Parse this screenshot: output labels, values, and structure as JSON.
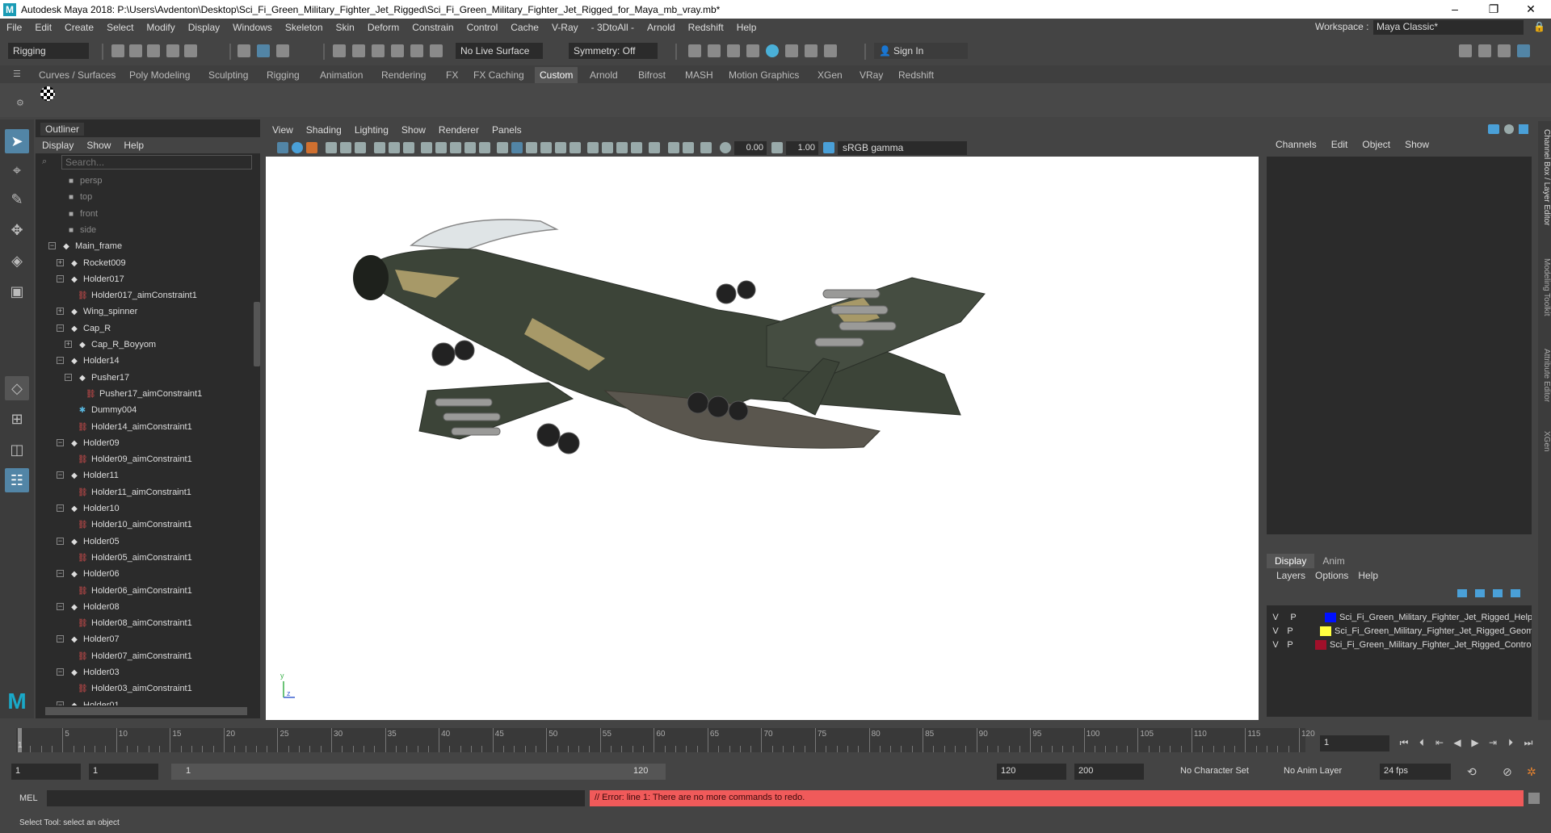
{
  "window": {
    "title": "Autodesk Maya 2018: P:\\Users\\Avdenton\\Desktop\\Sci_Fi_Green_Military_Fighter_Jet_Rigged\\Sci_Fi_Green_Military_Fighter_Jet_Rigged_for_Maya_mb_vray.mb*",
    "logo": "M",
    "minimize": "–",
    "maximize": "❐",
    "close": "✕"
  },
  "menubar": {
    "items": [
      "File",
      "Edit",
      "Create",
      "Select",
      "Modify",
      "Display",
      "Windows",
      "Skeleton",
      "Skin",
      "Deform",
      "Constrain",
      "Control",
      "Cache",
      "V-Ray",
      "- 3DtoAll -",
      "Arnold",
      "Redshift",
      "Help"
    ],
    "workspace_label": "Workspace :",
    "workspace_value": "Maya Classic*"
  },
  "statusline": {
    "menuset": "Rigging",
    "live_surface": "No Live Surface",
    "symmetry": "Symmetry: Off",
    "sign_in": "Sign In"
  },
  "shelf": {
    "tabs": [
      "Curves / Surfaces",
      "Poly Modeling",
      "Sculpting",
      "Rigging",
      "Animation",
      "Rendering",
      "FX",
      "FX Caching",
      "Custom",
      "Arnold",
      "Bifrost",
      "MASH",
      "Motion Graphics",
      "XGen",
      "VRay",
      "Redshift"
    ],
    "active_tab": "Custom"
  },
  "outliner": {
    "title": "Outliner",
    "menu": [
      "Display",
      "Show",
      "Help"
    ],
    "search_placeholder": "Search...",
    "items": [
      {
        "label": "persp",
        "type": "camera",
        "depth": 0,
        "expand": ""
      },
      {
        "label": "top",
        "type": "camera",
        "depth": 0,
        "expand": ""
      },
      {
        "label": "front",
        "type": "camera",
        "depth": 0,
        "expand": ""
      },
      {
        "label": "side",
        "type": "camera",
        "depth": 0,
        "expand": ""
      },
      {
        "label": "Main_frame",
        "type": "transform",
        "depth": 0,
        "expand": "−"
      },
      {
        "label": "Rocket009",
        "type": "transform",
        "depth": 1,
        "expand": "+"
      },
      {
        "label": "Holder017",
        "type": "transform",
        "depth": 1,
        "expand": "−"
      },
      {
        "label": "Holder017_aimConstraint1",
        "type": "constraint",
        "depth": 2,
        "expand": ""
      },
      {
        "label": "Wing_spinner",
        "type": "transform",
        "depth": 1,
        "expand": "+"
      },
      {
        "label": "Cap_R",
        "type": "transform",
        "depth": 1,
        "expand": "−"
      },
      {
        "label": "Cap_R_Boyyom",
        "type": "transform",
        "depth": 2,
        "expand": "+"
      },
      {
        "label": "Holder14",
        "type": "transform",
        "depth": 1,
        "expand": "−"
      },
      {
        "label": "Pusher17",
        "type": "transform",
        "depth": 2,
        "expand": "−"
      },
      {
        "label": "Pusher17_aimConstraint1",
        "type": "constraint",
        "depth": 3,
        "expand": ""
      },
      {
        "label": "Dummy004",
        "type": "dummy",
        "depth": 2,
        "expand": ""
      },
      {
        "label": "Holder14_aimConstraint1",
        "type": "constraint",
        "depth": 2,
        "expand": ""
      },
      {
        "label": "Holder09",
        "type": "transform",
        "depth": 1,
        "expand": "−"
      },
      {
        "label": "Holder09_aimConstraint1",
        "type": "constraint",
        "depth": 2,
        "expand": ""
      },
      {
        "label": "Holder11",
        "type": "transform",
        "depth": 1,
        "expand": "−"
      },
      {
        "label": "Holder11_aimConstraint1",
        "type": "constraint",
        "depth": 2,
        "expand": ""
      },
      {
        "label": "Holder10",
        "type": "transform",
        "depth": 1,
        "expand": "−"
      },
      {
        "label": "Holder10_aimConstraint1",
        "type": "constraint",
        "depth": 2,
        "expand": ""
      },
      {
        "label": "Holder05",
        "type": "transform",
        "depth": 1,
        "expand": "−"
      },
      {
        "label": "Holder05_aimConstraint1",
        "type": "constraint",
        "depth": 2,
        "expand": ""
      },
      {
        "label": "Holder06",
        "type": "transform",
        "depth": 1,
        "expand": "−"
      },
      {
        "label": "Holder06_aimConstraint1",
        "type": "constraint",
        "depth": 2,
        "expand": ""
      },
      {
        "label": "Holder08",
        "type": "transform",
        "depth": 1,
        "expand": "−"
      },
      {
        "label": "Holder08_aimConstraint1",
        "type": "constraint",
        "depth": 2,
        "expand": ""
      },
      {
        "label": "Holder07",
        "type": "transform",
        "depth": 1,
        "expand": "−"
      },
      {
        "label": "Holder07_aimConstraint1",
        "type": "constraint",
        "depth": 2,
        "expand": ""
      },
      {
        "label": "Holder03",
        "type": "transform",
        "depth": 1,
        "expand": "−"
      },
      {
        "label": "Holder03_aimConstraint1",
        "type": "constraint",
        "depth": 2,
        "expand": ""
      },
      {
        "label": "Holder01",
        "type": "transform",
        "depth": 1,
        "expand": "−"
      }
    ]
  },
  "viewport": {
    "menu": [
      "View",
      "Shading",
      "Lighting",
      "Show",
      "Renderer",
      "Panels"
    ],
    "exposure": "0.00",
    "gamma": "1.00",
    "color_space": "sRGB gamma",
    "axis_y": "y",
    "axis_z": "z"
  },
  "channelbox": {
    "menu": [
      "Channels",
      "Edit",
      "Object",
      "Show"
    ]
  },
  "layereditor": {
    "tabs": [
      "Display",
      "Anim"
    ],
    "active_tab": "Display",
    "menu": [
      "Layers",
      "Options",
      "Help"
    ],
    "layers": [
      {
        "v": "V",
        "p": "P",
        "color": "#0010ff",
        "name": "Sci_Fi_Green_Military_Fighter_Jet_Rigged_Help"
      },
      {
        "v": "V",
        "p": "P",
        "color": "#ffff40",
        "name": "Sci_Fi_Green_Military_Fighter_Jet_Rigged_Geom"
      },
      {
        "v": "V",
        "p": "P",
        "color": "#a0102a",
        "name": "Sci_Fi_Green_Military_Fighter_Jet_Rigged_Contro"
      }
    ]
  },
  "side_tabs": [
    "Channel Box / Layer Editor",
    "Modeling Toolkit",
    "Attribute Editor",
    "XGen"
  ],
  "timeslider": {
    "ticks": [
      1,
      5,
      10,
      15,
      20,
      25,
      30,
      35,
      40,
      45,
      50,
      55,
      60,
      65,
      70,
      75,
      80,
      85,
      90,
      95,
      100,
      105,
      110,
      115,
      120
    ],
    "current_frame": "1",
    "current_frame_marker": "1"
  },
  "range": {
    "start": "1",
    "playback_start": "1",
    "range_start": "1",
    "range_end": "120",
    "playback_end": "120",
    "end": "200",
    "character_set": "No Character Set",
    "anim_layer": "No Anim Layer",
    "fps": "24 fps"
  },
  "cmdline": {
    "lang": "MEL",
    "error": "// Error: line 1: There are no more commands to redo."
  },
  "helpline": {
    "text": "Select Tool: select an object"
  }
}
